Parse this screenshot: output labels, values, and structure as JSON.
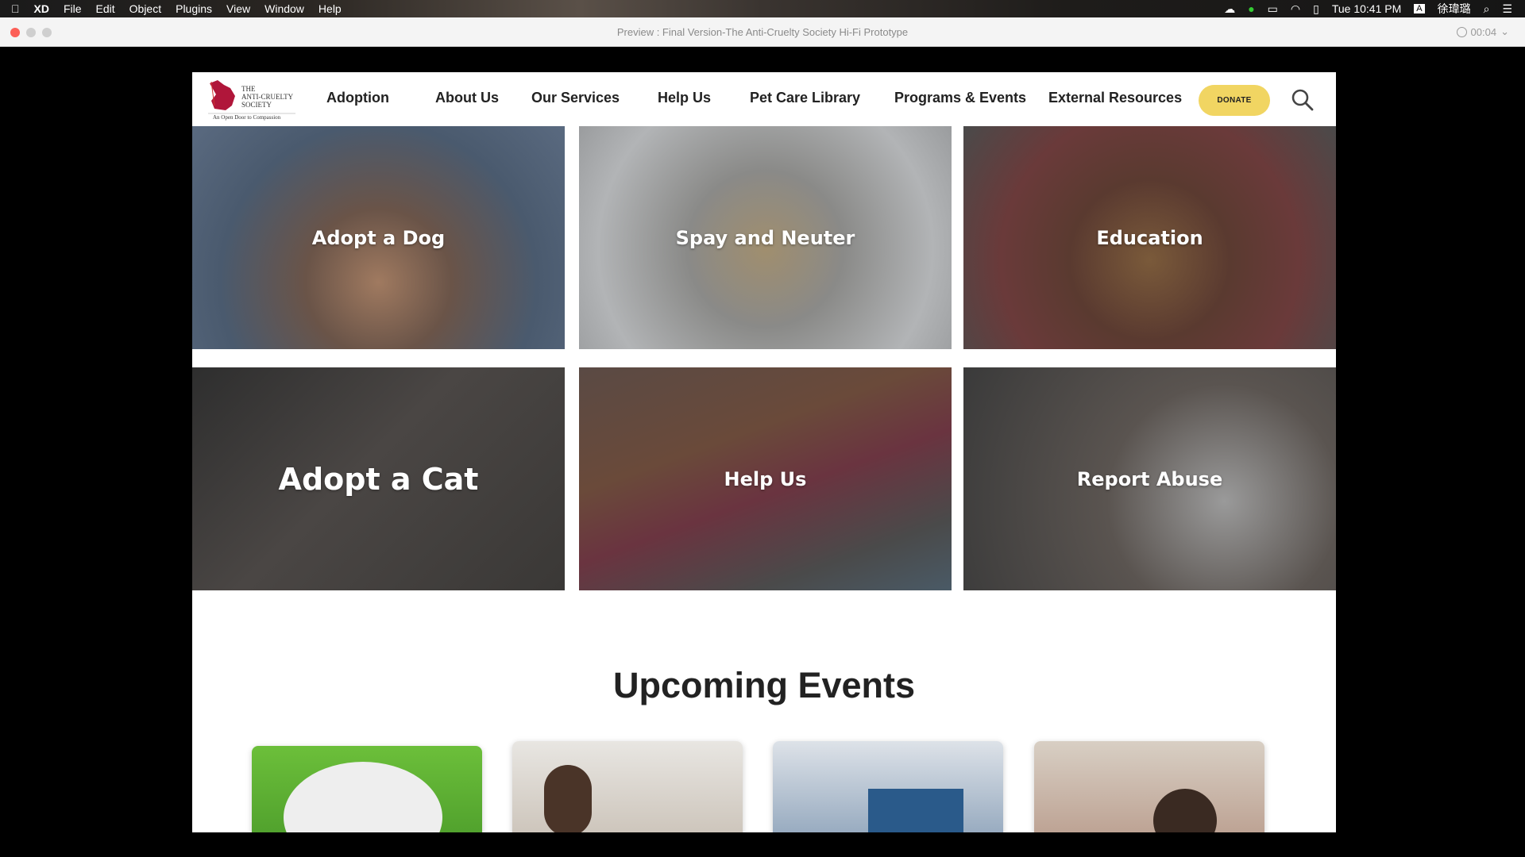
{
  "menubar": {
    "apple": "",
    "app": "XD",
    "items": [
      "File",
      "Edit",
      "Object",
      "Plugins",
      "View",
      "Window",
      "Help"
    ],
    "clock": "Tue 10:41 PM",
    "user": "徐瑋璐",
    "input": "A"
  },
  "window": {
    "title": "Preview : Final Version-The Anti-Cruelty Society Hi-Fi Prototype",
    "timer": "00:04"
  },
  "site": {
    "logo": {
      "line1": "THE",
      "line2": "ANTI-CRUELTY",
      "line3": "SOCIETY",
      "tagline": "An Open Door to Compassion",
      "brand_color": "#b0163a"
    },
    "nav": [
      "Adoption",
      "About Us",
      "Our Services",
      "Help Us",
      "Pet Care Library",
      "Programs & Events",
      "External Resources"
    ],
    "donate": "DONATE",
    "donate_color": "#f1d562",
    "tiles": [
      "Adopt a Dog",
      "Spay and Neuter",
      "Education",
      "Adopt a Cat",
      "Help Us",
      "Report Abuse"
    ],
    "events_title": "Upcoming Events"
  }
}
